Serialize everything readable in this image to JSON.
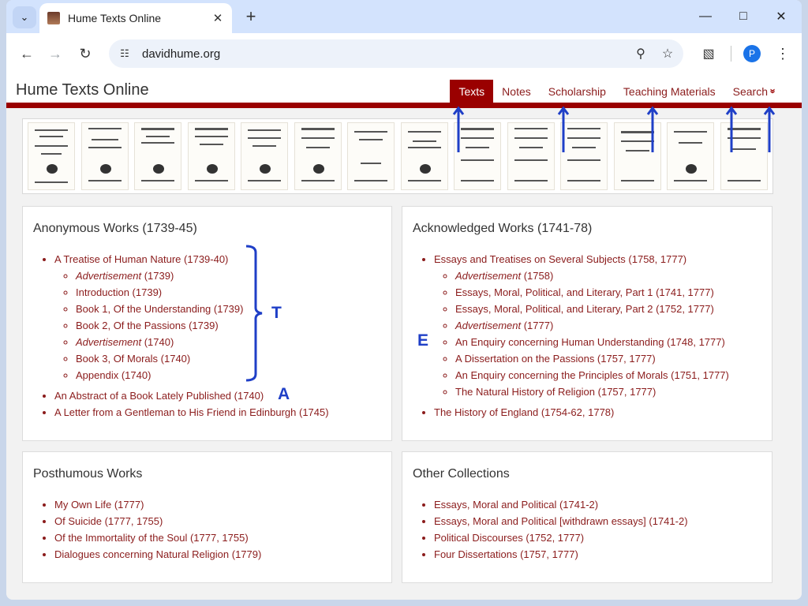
{
  "browser": {
    "tab_title": "Hume Texts Online",
    "url": "davidhume.org",
    "profile_initial": "P"
  },
  "site": {
    "title": "Hume Texts Online",
    "nav": [
      {
        "label": "Texts",
        "active": true
      },
      {
        "label": "Notes",
        "active": false
      },
      {
        "label": "Scholarship",
        "active": false
      },
      {
        "label": "Teaching Materials",
        "active": false
      },
      {
        "label": "Search",
        "active": false
      }
    ],
    "accent_color": "#9a0000"
  },
  "sections": {
    "anonymous": {
      "title": "Anonymous Works (1739-45)",
      "items": [
        {
          "label": "A Treatise of Human Nature (1739-40)",
          "children": [
            {
              "pre": "",
              "italic": "Advertisement",
              "post": " (1739)"
            },
            {
              "pre": "Introduction (1739)",
              "italic": "",
              "post": ""
            },
            {
              "pre": "Book 1, Of the Understanding (1739)",
              "italic": "",
              "post": ""
            },
            {
              "pre": "Book 2, Of the Passions (1739)",
              "italic": "",
              "post": ""
            },
            {
              "pre": "",
              "italic": "Advertisement",
              "post": " (1740)"
            },
            {
              "pre": "Book 3, Of Morals (1740)",
              "italic": "",
              "post": ""
            },
            {
              "pre": "Appendix (1740)",
              "italic": "",
              "post": ""
            }
          ]
        },
        {
          "label": "An Abstract of a Book Lately Published (1740)"
        },
        {
          "label": "A Letter from a Gentleman to His Friend in Edinburgh (1745)"
        }
      ]
    },
    "acknowledged": {
      "title": "Acknowledged Works (1741-78)",
      "items": [
        {
          "label": "Essays and Treatises on Several Subjects (1758, 1777)",
          "children": [
            {
              "pre": "",
              "italic": "Advertisement",
              "post": " (1758)"
            },
            {
              "pre": "Essays, Moral, Political, and Literary, Part 1 (1741, 1777)",
              "italic": "",
              "post": ""
            },
            {
              "pre": "Essays, Moral, Political, and Literary, Part 2 (1752, 1777)",
              "italic": "",
              "post": ""
            },
            {
              "pre": "",
              "italic": "Advertisement",
              "post": " (1777)"
            },
            {
              "pre": "An Enquiry concerning Human Understanding (1748, 1777)",
              "italic": "",
              "post": ""
            },
            {
              "pre": "A Dissertation on the Passions (1757, 1777)",
              "italic": "",
              "post": ""
            },
            {
              "pre": "An Enquiry concerning the Principles of Morals (1751, 1777)",
              "italic": "",
              "post": ""
            },
            {
              "pre": "The Natural History of Religion (1757, 1777)",
              "italic": "",
              "post": ""
            }
          ]
        },
        {
          "label": "The History of England (1754-62, 1778)"
        }
      ]
    },
    "posthumous": {
      "title": "Posthumous Works",
      "items": [
        {
          "label": "My Own Life (1777)"
        },
        {
          "label": "Of Suicide (1777, 1755)"
        },
        {
          "label": "Of the Immortality of the Soul (1777, 1755)"
        },
        {
          "label": "Dialogues concerning Natural Religion (1779)"
        }
      ]
    },
    "other": {
      "title": "Other Collections",
      "items": [
        {
          "label": "Essays, Moral and Political (1741-2)"
        },
        {
          "label": "Essays, Moral and Political [withdrawn essays] (1741-2)"
        },
        {
          "label": "Political Discourses (1752, 1777)"
        },
        {
          "label": "Four Dissertations (1757, 1777)"
        }
      ]
    }
  },
  "annotations": {
    "t": "T",
    "a": "A",
    "e": "E",
    "color": "#1f3fc7"
  }
}
